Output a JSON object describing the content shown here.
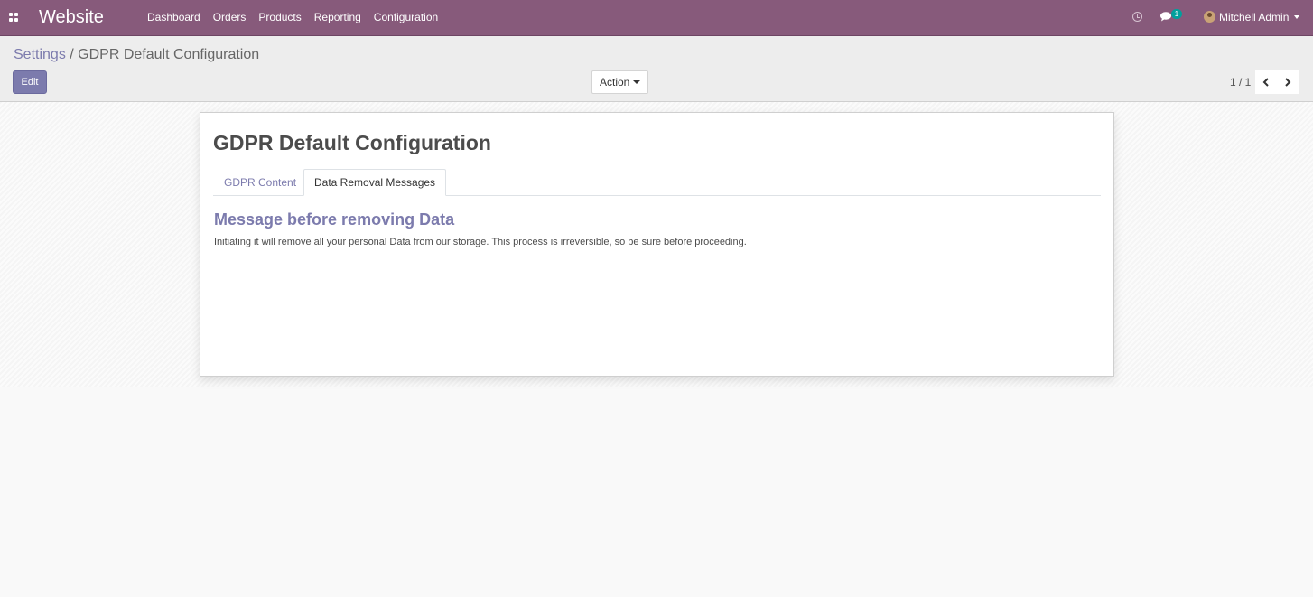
{
  "navbar": {
    "brand": "Website",
    "menu": [
      "Dashboard",
      "Orders",
      "Products",
      "Reporting",
      "Configuration"
    ],
    "chat_count": "1",
    "user_name": "Mitchell Admin",
    "colors": {
      "bar": "#875a7b",
      "badge": "#00a09d"
    }
  },
  "control_panel": {
    "breadcrumb_parent": "Settings",
    "breadcrumb_separator": "/",
    "breadcrumb_current": "GDPR Default Configuration",
    "edit_label": "Edit",
    "action_label": "Action",
    "pager": "1 / 1"
  },
  "form": {
    "title": "GDPR Default Configuration",
    "tabs": [
      {
        "label": "GDPR Content"
      },
      {
        "label": "Data Removal Messages"
      }
    ],
    "active_tab": "Data Removal Messages",
    "section_title": "Message before removing Data",
    "section_text": "Initiating it will remove all your personal Data from our storage. This process is irreversible, so be sure before proceeding.",
    "accent_color": "#7c7bad"
  }
}
